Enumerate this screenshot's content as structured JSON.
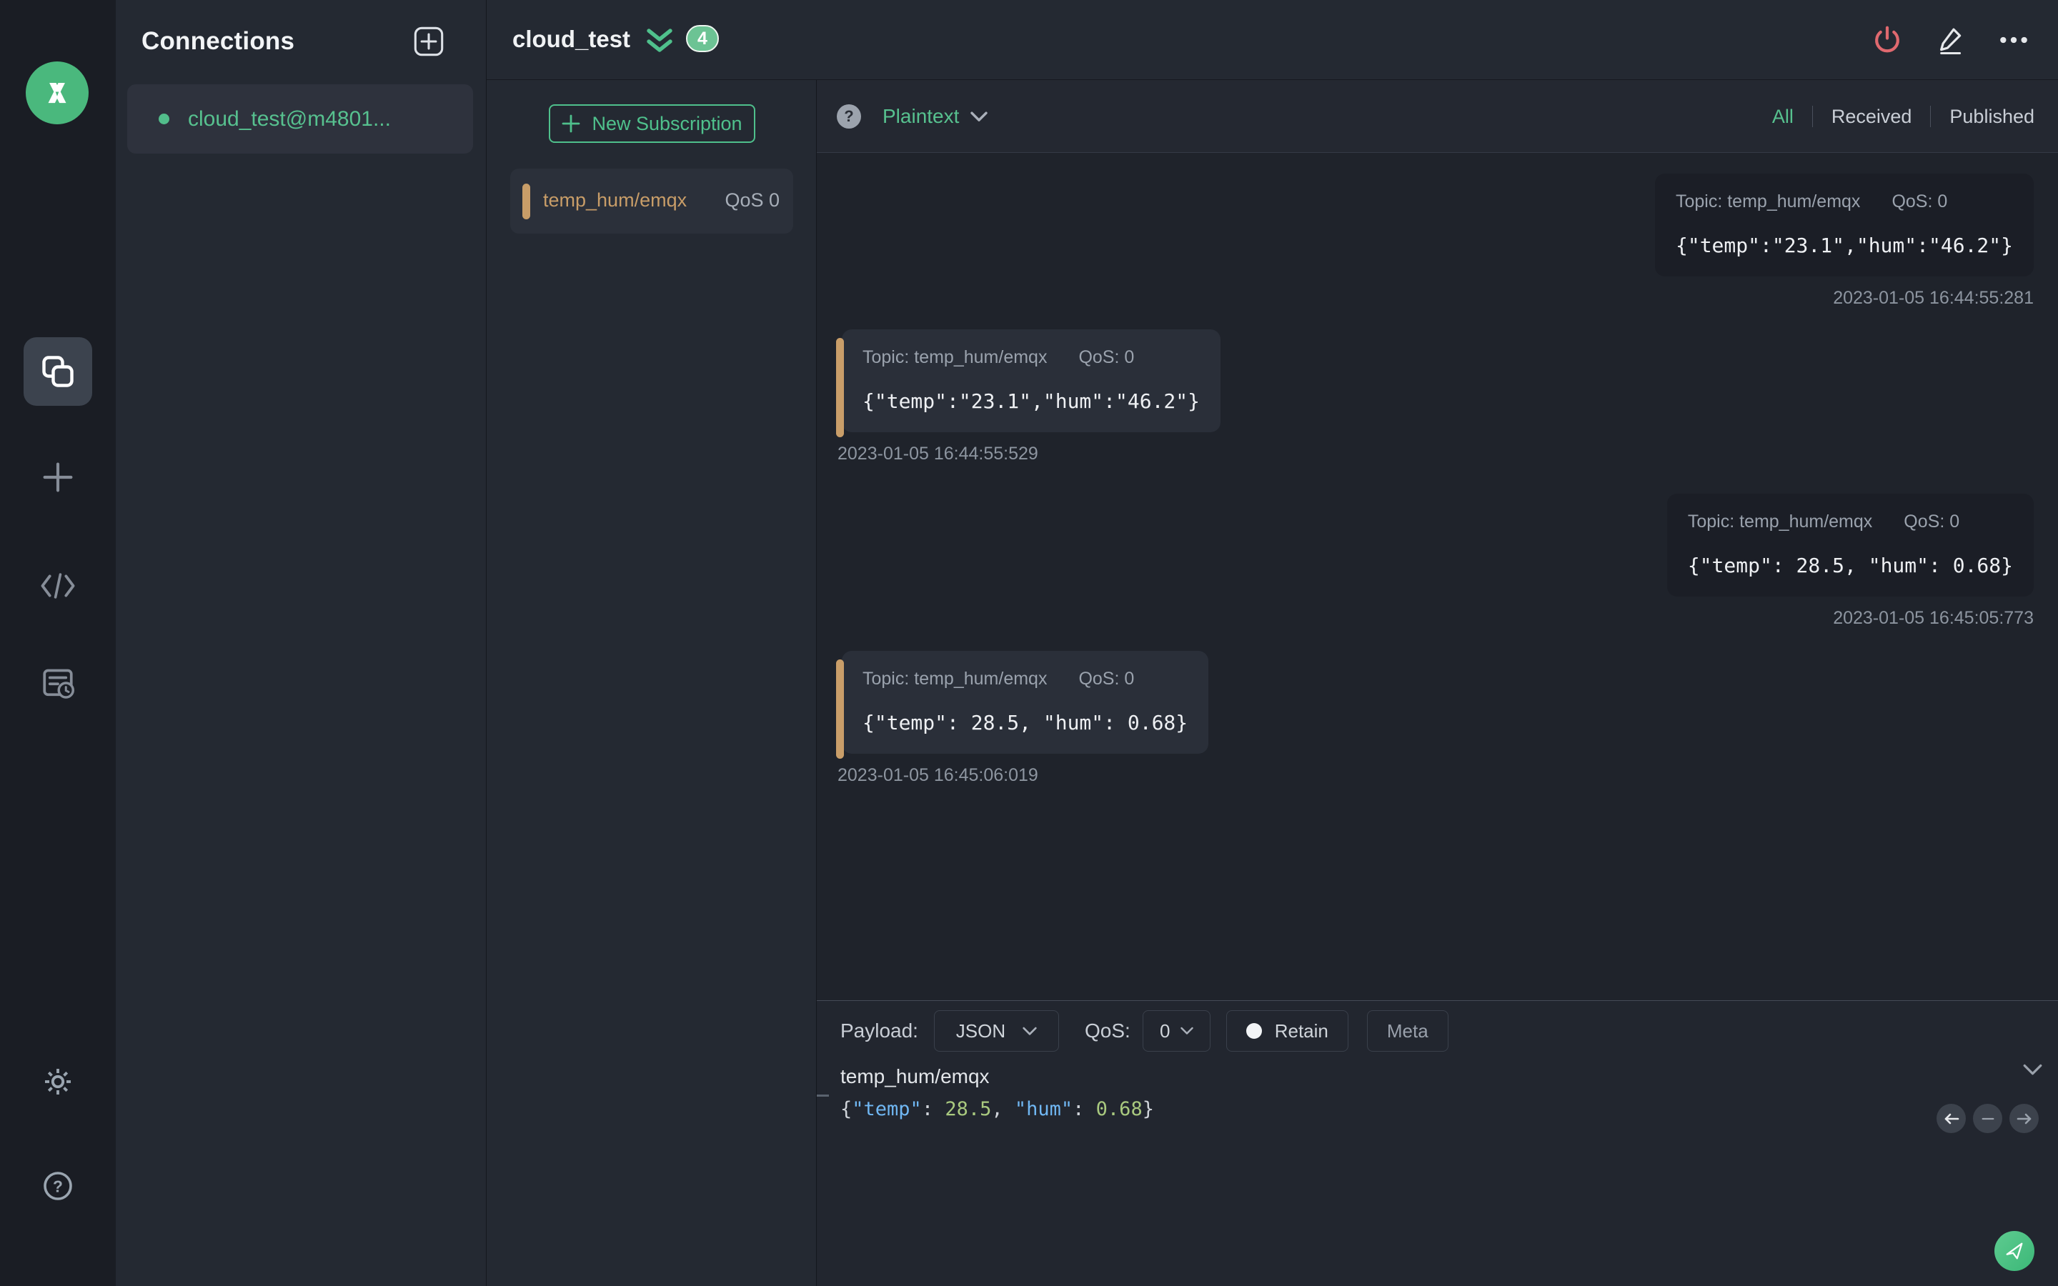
{
  "app": {
    "name": "MQTTX"
  },
  "colors": {
    "accent_green": "#4fc08c",
    "badge_green": "#6cc394",
    "topic_tan": "#c89d68",
    "power_red": "#e0696f",
    "json_key_blue": "#70b7f3",
    "json_num_green": "#a9c97f"
  },
  "connections_panel": {
    "title": "Connections",
    "connections": [
      {
        "name": "cloud_test@m4801...",
        "status": "connected"
      }
    ]
  },
  "main_header": {
    "connection_name": "cloud_test",
    "unread_badge": "4"
  },
  "subscriptions": {
    "new_subscription_label": "New Subscription",
    "items": [
      {
        "topic": "temp_hum/emqx",
        "qos": "QoS 0"
      }
    ]
  },
  "messages_toolbar": {
    "payload_format": "Plaintext",
    "filters": {
      "all": "All",
      "received": "Received",
      "published": "Published"
    },
    "active_filter": "All"
  },
  "messages": [
    {
      "type": "published",
      "topic": "Topic: temp_hum/emqx",
      "qos": "QoS: 0",
      "payload": "{\"temp\":\"23.1\",\"hum\":\"46.2\"}",
      "timestamp": "2023-01-05 16:44:55:281"
    },
    {
      "type": "received",
      "topic": "Topic: temp_hum/emqx",
      "qos": "QoS: 0",
      "payload": "{\"temp\":\"23.1\",\"hum\":\"46.2\"}",
      "timestamp": "2023-01-05 16:44:55:529"
    },
    {
      "type": "published",
      "topic": "Topic: temp_hum/emqx",
      "qos": "QoS: 0",
      "payload": "{\"temp\": 28.5, \"hum\": 0.68}",
      "timestamp": "2023-01-05 16:45:05:773"
    },
    {
      "type": "received",
      "topic": "Topic: temp_hum/emqx",
      "qos": "QoS: 0",
      "payload": "{\"temp\": 28.5, \"hum\": 0.68}",
      "timestamp": "2023-01-05 16:45:06:019"
    }
  ],
  "publish_panel": {
    "payload_label": "Payload:",
    "payload_format": "JSON",
    "qos_label": "QoS:",
    "qos_value": "0",
    "retain_label": "Retain",
    "meta_label": "Meta",
    "topic_value": "temp_hum/emqx",
    "payload_tokens": [
      {
        "text": "{",
        "type": "punct"
      },
      {
        "text": "\"temp\"",
        "type": "key"
      },
      {
        "text": ": ",
        "type": "punct"
      },
      {
        "text": "28.5",
        "type": "num"
      },
      {
        "text": ", ",
        "type": "punct"
      },
      {
        "text": "\"hum\"",
        "type": "key"
      },
      {
        "text": ": ",
        "type": "punct"
      },
      {
        "text": "0.68",
        "type": "num"
      },
      {
        "text": "}",
        "type": "punct"
      }
    ]
  }
}
